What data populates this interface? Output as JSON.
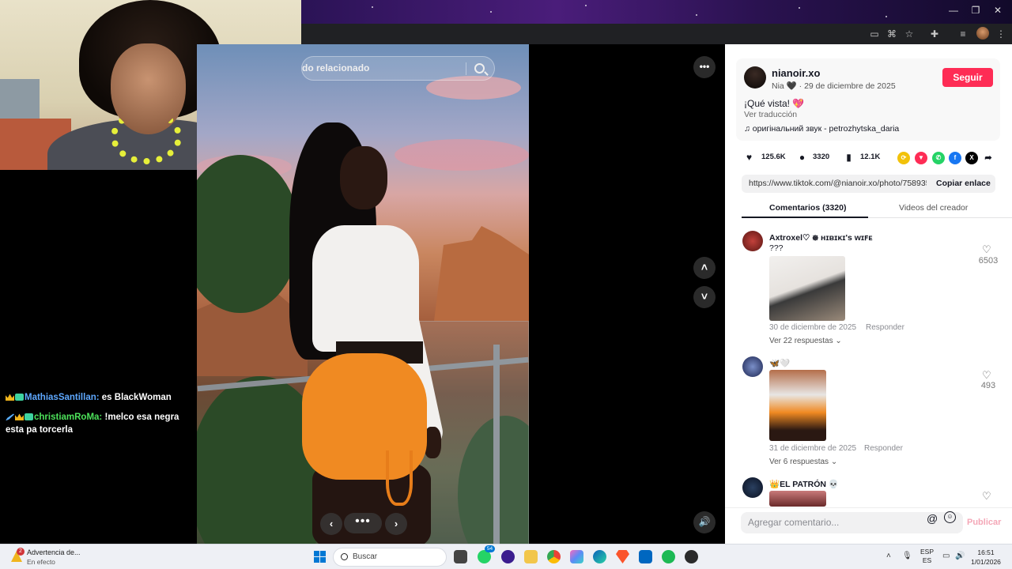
{
  "browser": {
    "window_controls": [
      "—",
      "❐",
      "✕"
    ]
  },
  "chat": {
    "messages": [
      {
        "user": "MathiasSantillan:",
        "text": "es BlackWoman"
      },
      {
        "user": "christiamRoMa:",
        "text": "!melco esa negra esta pa torcerla"
      }
    ]
  },
  "photo": {
    "search_text": "do relacionado"
  },
  "post": {
    "author": "nianoir.xo",
    "meta": "Nia 🖤 · 29 de diciembre de 2025",
    "follow_label": "Seguir",
    "caption": "¡Qué vista! 💖",
    "translate_label": "Ver traducción",
    "sound": "оригінальний звук - petrozhytska_daria",
    "likes": "125.6K",
    "comments": "3320",
    "saves": "12.1K",
    "link_url": "https://www.tiktok.com/@nianoir.xo/photo/758935...",
    "copy_label": "Copiar enlace"
  },
  "tabs": {
    "comments": "Comentarios (3320)",
    "creator_videos": "Videos del creador"
  },
  "comments": [
    {
      "user": "Axtroxel♡ ᪥ ʜɪʙɪᴋɪ's ᴡɪꜰᴇ",
      "text": "???",
      "date": "30 de diciembre de 2025",
      "reply_label": "Responder",
      "more": "Ver 22 respuestas",
      "likes": "6503"
    },
    {
      "user": "🦋🤍",
      "text": "",
      "date": "31 de diciembre de 2025",
      "reply_label": "Responder",
      "more": "Ver 6 respuestas",
      "likes": "493"
    },
    {
      "user": "👑EL PATRÓN 💀",
      "text": "",
      "date": "",
      "reply_label": "",
      "more": "",
      "likes": ""
    }
  ],
  "input": {
    "placeholder": "Agregar comentario...",
    "at": "@",
    "publish_label": "Publicar"
  },
  "taskbar": {
    "warning_count": "2",
    "warning_title": "Advertencia de...",
    "warning_sub": "En efecto",
    "search_label": "Buscar",
    "whatsapp_badge": "54",
    "lang_top": "ESP",
    "lang_bottom": "ES",
    "time": "16:51",
    "date": "1/01/2026"
  },
  "colors": {
    "follow": "#fe2c55",
    "shorts": "#f08a22",
    "chat_user1": "#5ea8ff",
    "chat_user2": "#4de35b"
  }
}
